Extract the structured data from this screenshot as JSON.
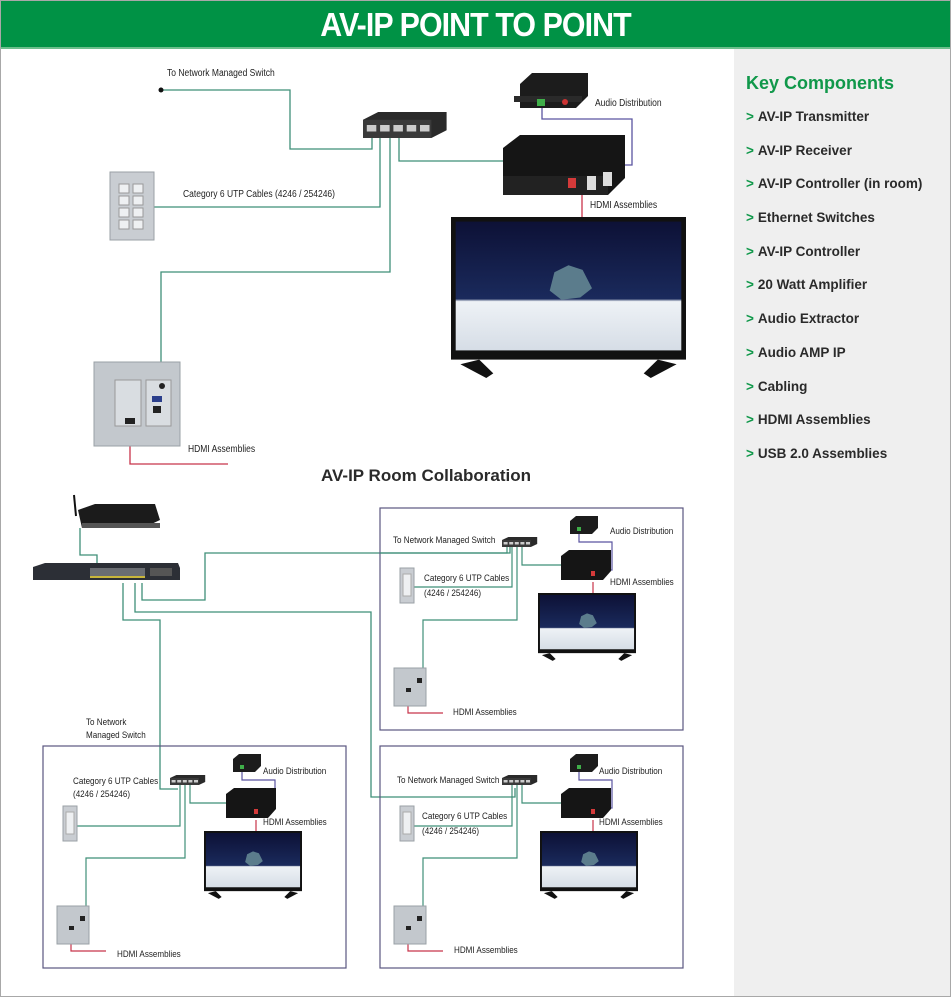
{
  "header": {
    "title": "AV-IP POINT TO POINT"
  },
  "sidebar": {
    "heading": "Key Components",
    "bullet": ">",
    "items": [
      {
        "label": "AV-IP Transmitter"
      },
      {
        "label": "AV-IP Receiver"
      },
      {
        "label": "AV-IP Controller (in room)"
      },
      {
        "label": "Ethernet Switches"
      },
      {
        "label": "AV-IP Controller"
      },
      {
        "label": "20 Watt Amplifier"
      },
      {
        "label": "Audio Extractor"
      },
      {
        "label": "Audio AMP IP"
      },
      {
        "label": "Cabling"
      },
      {
        "label": "HDMI Assemblies"
      },
      {
        "label": "USB 2.0 Assemblies"
      }
    ]
  },
  "point_to_point": {
    "to_switch": "To Network Managed Switch",
    "cables": "Category 6 UTP Cables (4246 / 254246)",
    "audio": "Audio Distribution",
    "hdmi_receiver": "HDMI Assemblies",
    "hdmi_transmitter": "HDMI Assemblies"
  },
  "collaboration": {
    "title": "AV-IP Room Collaboration",
    "rooms": [
      {
        "to_switch": "To Network Managed Switch",
        "cables_line1": "Category 6 UTP Cables",
        "cables_line2": "(4246 / 254246)",
        "audio": "Audio Distribution",
        "hdmi_receiver": "HDMI Assemblies",
        "hdmi_transmitter": "HDMI Assemblies"
      },
      {
        "to_switch_line1": "To Network",
        "to_switch_line2": "Managed Switch",
        "cables_line1": "Category 6 UTP Cables",
        "cables_line2": "(4246 / 254246)",
        "audio": "Audio Distribution",
        "hdmi_receiver": "HDMI Assemblies",
        "hdmi_transmitter": "HDMI Assemblies"
      },
      {
        "to_switch": "To Network Managed Switch",
        "cables_line1": "Category 6 UTP Cables",
        "cables_line2": "(4246 / 254246)",
        "audio": "Audio Distribution",
        "hdmi_receiver": "HDMI Assemblies",
        "hdmi_transmitter": "HDMI Assemblies"
      }
    ]
  },
  "colors": {
    "brand_green": "#009245",
    "ethernet_cable": "#3f8f78",
    "hdmi_cable": "#c8344a",
    "audio_cable": "#5a55a0",
    "room_border": "#5b5680"
  }
}
